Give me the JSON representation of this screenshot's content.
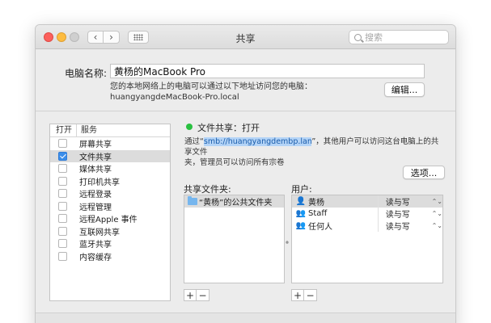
{
  "window": {
    "title": "共享"
  },
  "search": {
    "placeholder": "搜索"
  },
  "computer_name": {
    "label": "电脑名称:",
    "value": "黄杨的MacBook Pro",
    "desc_line1": "您的本地网络上的电脑可以通过以下地址访问您的电脑：",
    "desc_line2": "huangyangdeMacBook-Pro.local",
    "edit_label": "编辑..."
  },
  "services": {
    "col_on": "打开",
    "col_service": "服务",
    "items": [
      {
        "label": "屏幕共享",
        "checked": false
      },
      {
        "label": "文件共享",
        "checked": true
      },
      {
        "label": "媒体共享",
        "checked": false
      },
      {
        "label": "打印机共享",
        "checked": false
      },
      {
        "label": "远程登录",
        "checked": false
      },
      {
        "label": "远程管理",
        "checked": false
      },
      {
        "label": "远程Apple 事件",
        "checked": false
      },
      {
        "label": "互联网共享",
        "checked": false
      },
      {
        "label": "蓝牙共享",
        "checked": false
      },
      {
        "label": "内容缓存",
        "checked": false
      }
    ]
  },
  "file_sharing": {
    "status": "文件共享：打开",
    "info_pre": "通过“",
    "info_link": "smb://huangyangdembp.lan",
    "info_post": "”，其他用户可以访问这台电脑上的共享文件",
    "info_line2": "夹，管理员可以访问所有宗卷",
    "options_label": "选项...",
    "folders_label": "共享文件夹:",
    "folders": [
      "“黄杨”的公共文件夹"
    ],
    "users_label": "用户:",
    "users": [
      {
        "name": "黄杨",
        "perm": "读与写",
        "icon": "person-icon"
      },
      {
        "name": "Staff",
        "perm": "读与写",
        "icon": "group-icon"
      },
      {
        "name": "任何人",
        "perm": "读与写",
        "icon": "group-icon"
      }
    ],
    "add": "+",
    "remove": "−"
  }
}
